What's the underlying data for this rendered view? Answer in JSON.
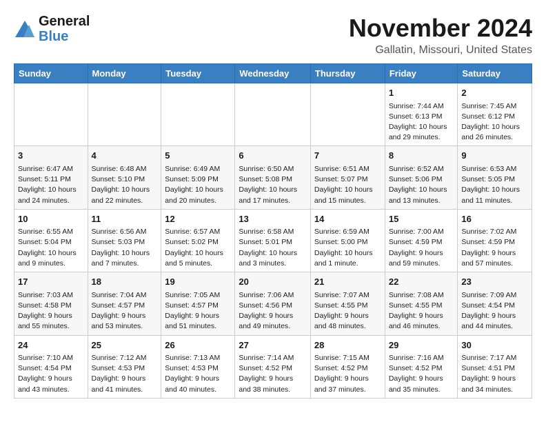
{
  "header": {
    "logo_general": "General",
    "logo_blue": "Blue",
    "month": "November 2024",
    "location": "Gallatin, Missouri, United States"
  },
  "weekdays": [
    "Sunday",
    "Monday",
    "Tuesday",
    "Wednesday",
    "Thursday",
    "Friday",
    "Saturday"
  ],
  "weeks": [
    [
      null,
      null,
      null,
      null,
      null,
      {
        "day": "1",
        "sunrise": "Sunrise: 7:44 AM",
        "sunset": "Sunset: 6:13 PM",
        "daylight": "Daylight: 10 hours and 29 minutes."
      },
      {
        "day": "2",
        "sunrise": "Sunrise: 7:45 AM",
        "sunset": "Sunset: 6:12 PM",
        "daylight": "Daylight: 10 hours and 26 minutes."
      }
    ],
    [
      {
        "day": "3",
        "sunrise": "Sunrise: 6:47 AM",
        "sunset": "Sunset: 5:11 PM",
        "daylight": "Daylight: 10 hours and 24 minutes."
      },
      {
        "day": "4",
        "sunrise": "Sunrise: 6:48 AM",
        "sunset": "Sunset: 5:10 PM",
        "daylight": "Daylight: 10 hours and 22 minutes."
      },
      {
        "day": "5",
        "sunrise": "Sunrise: 6:49 AM",
        "sunset": "Sunset: 5:09 PM",
        "daylight": "Daylight: 10 hours and 20 minutes."
      },
      {
        "day": "6",
        "sunrise": "Sunrise: 6:50 AM",
        "sunset": "Sunset: 5:08 PM",
        "daylight": "Daylight: 10 hours and 17 minutes."
      },
      {
        "day": "7",
        "sunrise": "Sunrise: 6:51 AM",
        "sunset": "Sunset: 5:07 PM",
        "daylight": "Daylight: 10 hours and 15 minutes."
      },
      {
        "day": "8",
        "sunrise": "Sunrise: 6:52 AM",
        "sunset": "Sunset: 5:06 PM",
        "daylight": "Daylight: 10 hours and 13 minutes."
      },
      {
        "day": "9",
        "sunrise": "Sunrise: 6:53 AM",
        "sunset": "Sunset: 5:05 PM",
        "daylight": "Daylight: 10 hours and 11 minutes."
      }
    ],
    [
      {
        "day": "10",
        "sunrise": "Sunrise: 6:55 AM",
        "sunset": "Sunset: 5:04 PM",
        "daylight": "Daylight: 10 hours and 9 minutes."
      },
      {
        "day": "11",
        "sunrise": "Sunrise: 6:56 AM",
        "sunset": "Sunset: 5:03 PM",
        "daylight": "Daylight: 10 hours and 7 minutes."
      },
      {
        "day": "12",
        "sunrise": "Sunrise: 6:57 AM",
        "sunset": "Sunset: 5:02 PM",
        "daylight": "Daylight: 10 hours and 5 minutes."
      },
      {
        "day": "13",
        "sunrise": "Sunrise: 6:58 AM",
        "sunset": "Sunset: 5:01 PM",
        "daylight": "Daylight: 10 hours and 3 minutes."
      },
      {
        "day": "14",
        "sunrise": "Sunrise: 6:59 AM",
        "sunset": "Sunset: 5:00 PM",
        "daylight": "Daylight: 10 hours and 1 minute."
      },
      {
        "day": "15",
        "sunrise": "Sunrise: 7:00 AM",
        "sunset": "Sunset: 4:59 PM",
        "daylight": "Daylight: 9 hours and 59 minutes."
      },
      {
        "day": "16",
        "sunrise": "Sunrise: 7:02 AM",
        "sunset": "Sunset: 4:59 PM",
        "daylight": "Daylight: 9 hours and 57 minutes."
      }
    ],
    [
      {
        "day": "17",
        "sunrise": "Sunrise: 7:03 AM",
        "sunset": "Sunset: 4:58 PM",
        "daylight": "Daylight: 9 hours and 55 minutes."
      },
      {
        "day": "18",
        "sunrise": "Sunrise: 7:04 AM",
        "sunset": "Sunset: 4:57 PM",
        "daylight": "Daylight: 9 hours and 53 minutes."
      },
      {
        "day": "19",
        "sunrise": "Sunrise: 7:05 AM",
        "sunset": "Sunset: 4:57 PM",
        "daylight": "Daylight: 9 hours and 51 minutes."
      },
      {
        "day": "20",
        "sunrise": "Sunrise: 7:06 AM",
        "sunset": "Sunset: 4:56 PM",
        "daylight": "Daylight: 9 hours and 49 minutes."
      },
      {
        "day": "21",
        "sunrise": "Sunrise: 7:07 AM",
        "sunset": "Sunset: 4:55 PM",
        "daylight": "Daylight: 9 hours and 48 minutes."
      },
      {
        "day": "22",
        "sunrise": "Sunrise: 7:08 AM",
        "sunset": "Sunset: 4:55 PM",
        "daylight": "Daylight: 9 hours and 46 minutes."
      },
      {
        "day": "23",
        "sunrise": "Sunrise: 7:09 AM",
        "sunset": "Sunset: 4:54 PM",
        "daylight": "Daylight: 9 hours and 44 minutes."
      }
    ],
    [
      {
        "day": "24",
        "sunrise": "Sunrise: 7:10 AM",
        "sunset": "Sunset: 4:54 PM",
        "daylight": "Daylight: 9 hours and 43 minutes."
      },
      {
        "day": "25",
        "sunrise": "Sunrise: 7:12 AM",
        "sunset": "Sunset: 4:53 PM",
        "daylight": "Daylight: 9 hours and 41 minutes."
      },
      {
        "day": "26",
        "sunrise": "Sunrise: 7:13 AM",
        "sunset": "Sunset: 4:53 PM",
        "daylight": "Daylight: 9 hours and 40 minutes."
      },
      {
        "day": "27",
        "sunrise": "Sunrise: 7:14 AM",
        "sunset": "Sunset: 4:52 PM",
        "daylight": "Daylight: 9 hours and 38 minutes."
      },
      {
        "day": "28",
        "sunrise": "Sunrise: 7:15 AM",
        "sunset": "Sunset: 4:52 PM",
        "daylight": "Daylight: 9 hours and 37 minutes."
      },
      {
        "day": "29",
        "sunrise": "Sunrise: 7:16 AM",
        "sunset": "Sunset: 4:52 PM",
        "daylight": "Daylight: 9 hours and 35 minutes."
      },
      {
        "day": "30",
        "sunrise": "Sunrise: 7:17 AM",
        "sunset": "Sunset: 4:51 PM",
        "daylight": "Daylight: 9 hours and 34 minutes."
      }
    ]
  ]
}
